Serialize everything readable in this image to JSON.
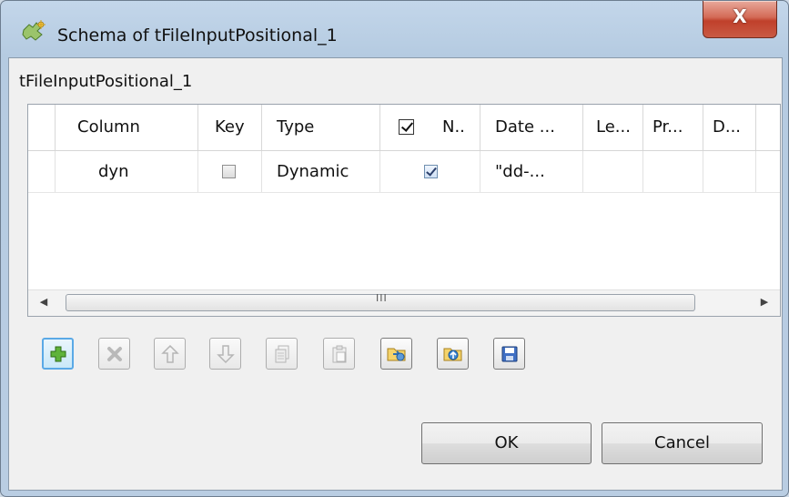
{
  "window": {
    "title": "Schema of tFileInputPositional_1",
    "close_label": "X"
  },
  "group": {
    "label": "tFileInputPositional_1"
  },
  "table": {
    "headers": {
      "column": "Column",
      "key": "Key",
      "type": "Type",
      "nullable": "N..",
      "date_pattern": "Date ...",
      "length": "Le...",
      "precision": "Pr...",
      "default": "D..."
    },
    "rows": [
      {
        "column": "dyn",
        "key": false,
        "type": "Dynamic",
        "nullable": true,
        "date_pattern": "\"dd-...",
        "length": "",
        "precision": "",
        "default": ""
      }
    ],
    "scrollbar_grip": "III"
  },
  "toolbar": {
    "buttons": [
      {
        "name": "add",
        "icon": "plus-icon",
        "enabled": true
      },
      {
        "name": "remove",
        "icon": "delete-icon",
        "enabled": false
      },
      {
        "name": "move-up",
        "icon": "arrow-up-icon",
        "enabled": false
      },
      {
        "name": "move-down",
        "icon": "arrow-down-icon",
        "enabled": false
      },
      {
        "name": "copy",
        "icon": "copy-icon",
        "enabled": false
      },
      {
        "name": "paste",
        "icon": "paste-icon",
        "enabled": false
      },
      {
        "name": "import",
        "icon": "import-folder-icon",
        "enabled": true
      },
      {
        "name": "export",
        "icon": "export-folder-icon",
        "enabled": true
      },
      {
        "name": "save",
        "icon": "save-icon",
        "enabled": true
      }
    ]
  },
  "buttons": {
    "ok": "OK",
    "cancel": "Cancel"
  },
  "colors": {
    "frame": "#b9cde2",
    "close_button": "#c9453a",
    "client_bg": "#f0f0f0",
    "active_toolbar_border": "#5aa9e6"
  }
}
